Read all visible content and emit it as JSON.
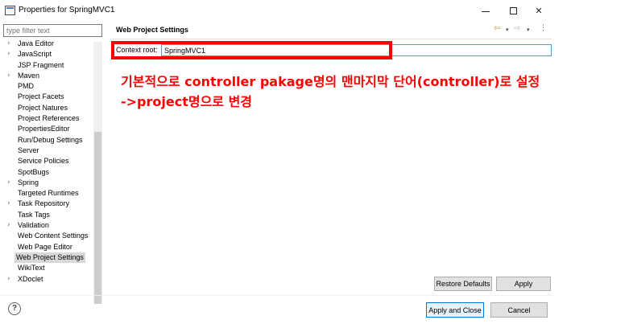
{
  "window": {
    "title": "Properties for SpringMVC1",
    "icon": "eclipse-properties-icon",
    "minimize": "minimize",
    "maximize": "maximize",
    "close": "✕"
  },
  "filter": {
    "placeholder": "type filter text",
    "value": ""
  },
  "tree": [
    {
      "label": "Java Editor",
      "expandable": true
    },
    {
      "label": "JavaScript",
      "expandable": true
    },
    {
      "label": "JSP Fragment",
      "expandable": false
    },
    {
      "label": "Maven",
      "expandable": true
    },
    {
      "label": "PMD",
      "expandable": false
    },
    {
      "label": "Project Facets",
      "expandable": false
    },
    {
      "label": "Project Natures",
      "expandable": false
    },
    {
      "label": "Project References",
      "expandable": false
    },
    {
      "label": "PropertiesEditor",
      "expandable": false
    },
    {
      "label": "Run/Debug Settings",
      "expandable": false
    },
    {
      "label": "Server",
      "expandable": false
    },
    {
      "label": "Service Policies",
      "expandable": false
    },
    {
      "label": "SpotBugs",
      "expandable": false
    },
    {
      "label": "Spring",
      "expandable": true
    },
    {
      "label": "Targeted Runtimes",
      "expandable": false
    },
    {
      "label": "Task Repository",
      "expandable": true
    },
    {
      "label": "Task Tags",
      "expandable": false
    },
    {
      "label": "Validation",
      "expandable": true
    },
    {
      "label": "Web Content Settings",
      "expandable": false
    },
    {
      "label": "Web Page Editor",
      "expandable": false
    },
    {
      "label": "Web Project Settings",
      "expandable": false,
      "selected": true
    },
    {
      "label": "WikiText",
      "expandable": false
    },
    {
      "label": "XDoclet",
      "expandable": true
    }
  ],
  "page": {
    "title": "Web Project Settings",
    "context_root_label": "Context root:",
    "context_root_value": "SpringMVC1",
    "restore_defaults": "Restore Defaults",
    "apply": "Apply"
  },
  "annotation": {
    "line1": "기본적으로 controller pakage명의 맨마지막 단어(controller)로 설정",
    "line2": "->project명으로 변경",
    "color": "#ff0000"
  },
  "footer": {
    "help": "?",
    "apply_and_close": "Apply and Close",
    "cancel": "Cancel"
  },
  "icons": {
    "back": "⇦",
    "forward": "⇨",
    "dropdown": "▾",
    "menu": "⋮",
    "chevron": "›"
  }
}
